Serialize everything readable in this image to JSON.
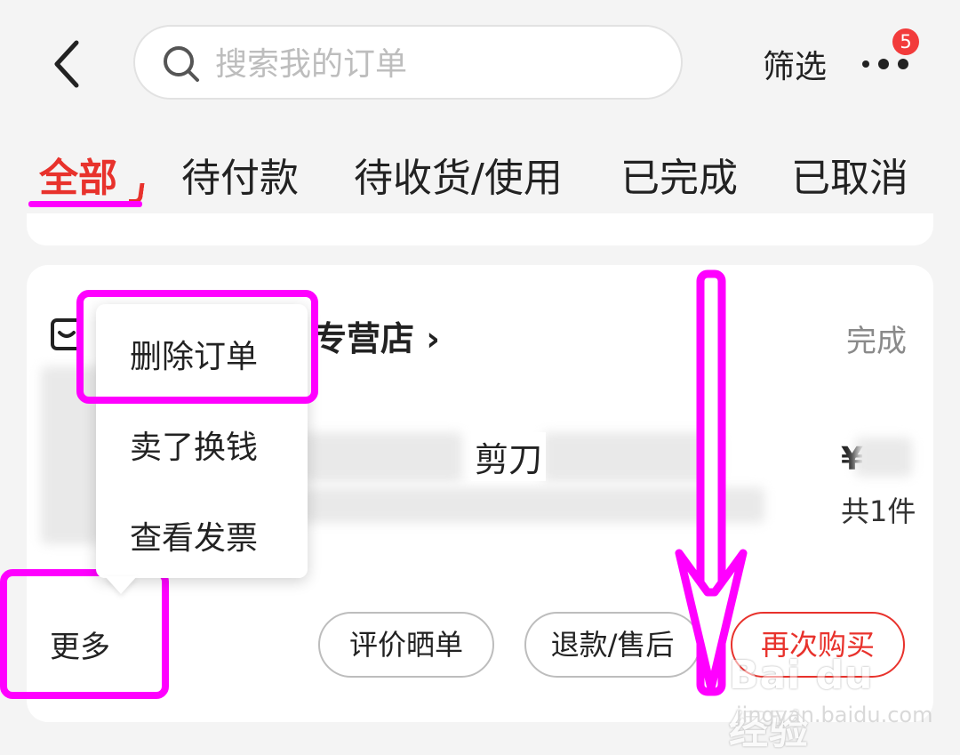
{
  "header": {
    "search_placeholder": "搜索我的订单",
    "filter_label": "筛选",
    "more_badge": "5"
  },
  "tabs": [
    {
      "label": "全部",
      "active": true
    },
    {
      "label": "待付款",
      "active": false
    },
    {
      "label": "待收货/使用",
      "active": false
    },
    {
      "label": "已完成",
      "active": false
    },
    {
      "label": "已取消",
      "active": false
    }
  ],
  "order": {
    "shop_name_visible": "专营店",
    "status": "完成",
    "product_title_visible": "剪刀",
    "price_symbol": "¥",
    "quantity": "共1件"
  },
  "popup_menu": {
    "items": [
      "删除订单",
      "卖了换钱",
      "查看发票"
    ]
  },
  "actions": {
    "more": "更多",
    "review": "评价晒单",
    "refund": "退款/售后",
    "rebuy": "再次购买"
  },
  "watermark": {
    "logo": "Bai du 经验",
    "url": "jingyan.baidu.com"
  },
  "colors": {
    "accent_red": "#e8322c",
    "highlight_magenta": "#ff00ff",
    "badge_red": "#f23b3b"
  }
}
